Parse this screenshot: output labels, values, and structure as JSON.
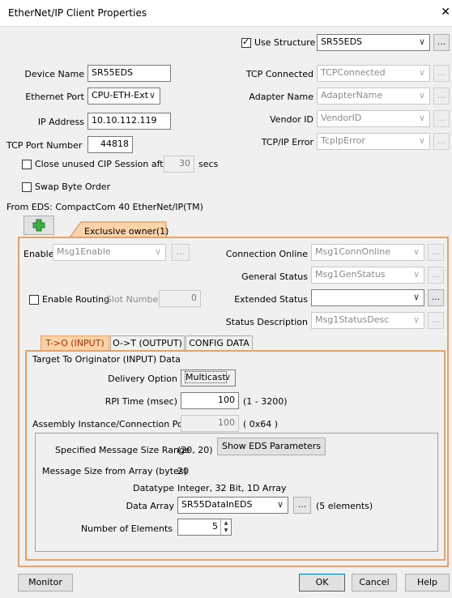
{
  "window": {
    "title": "EtherNet/IP Client Properties",
    "close": "✕"
  },
  "header": {
    "use_structure_label": "Use Structure",
    "use_structure_checked": true,
    "structure_value": "SR55EDS",
    "device_name_label": "Device Name",
    "device_name_value": "SR55EDS",
    "ethernet_port_label": "Ethernet Port",
    "ethernet_port_value": "CPU-ETH-Ext",
    "ip_address_label": "IP Address",
    "ip_address_value": "10.10.112.119",
    "tcp_port_label": "TCP Port Number",
    "tcp_port_value": "44818",
    "tcp_connected_label": "TCP Connected",
    "tcp_connected_value": "TCPConnected",
    "adapter_name_label": "Adapter Name",
    "adapter_name_value": "AdapterName",
    "vendor_id_label": "Vendor ID",
    "vendor_id_value": "VendorID",
    "tcpip_error_label": "TCP/IP Error",
    "tcpip_error_value": "TcpIpError",
    "close_unused_label": "Close unused CIP Session after",
    "close_unused_value": "30",
    "secs_label": "secs",
    "swap_byte_label": "Swap Byte Order",
    "from_eds_label": "From EDS: CompactCom 40 EtherNet/IP(TM)",
    "ellipsis": "..."
  },
  "conn_tab": {
    "label": "Exclusive owner(1)"
  },
  "conn": {
    "enable_label": "Enable",
    "enable_value": "Msg1Enable",
    "connection_online_label": "Connection Online",
    "connection_online_value": "Msg1ConnOnline",
    "general_status_label": "General Status",
    "general_status_value": "Msg1GenStatus",
    "enable_routing_label": "Enable Routing",
    "slot_number_label": "Slot Number",
    "slot_number_value": "0",
    "extended_status_label": "Extended Status",
    "extended_status_value": "",
    "status_description_label": "Status Description",
    "status_description_value": "Msg1StatusDesc"
  },
  "io_tabs": [
    {
      "label": "T->O (INPUT)",
      "active": true
    },
    {
      "label": "O->T (OUTPUT)",
      "active": false
    },
    {
      "label": "CONFIG DATA",
      "active": false
    }
  ],
  "input": {
    "group_title": "Target To Originator (INPUT) Data",
    "delivery_option_label": "Delivery Option",
    "delivery_option_value": "Multicast",
    "rpi_label": "RPI Time (msec)",
    "rpi_value": "100",
    "rpi_range": "(1 - 3200)",
    "assembly_label": "Assembly Instance/Connection Point",
    "assembly_value": "100",
    "assembly_hex": "( 0x64 )",
    "specified_range_label": "Specified Message Size Range",
    "specified_range_value": "(20, 20)",
    "show_eds_button": "Show EDS Parameters",
    "msg_size_label": "Message Size from Array (bytes)",
    "msg_size_value": "20",
    "datatype_label": "Datatype",
    "datatype_value": "Integer, 32 Bit, 1D Array",
    "data_array_label": "Data Array",
    "data_array_value": "SR55DataInEDS",
    "elements_note": "(5 elements)",
    "num_elements_label": "Number of Elements",
    "num_elements_value": "5"
  },
  "footer": {
    "monitor": "Monitor",
    "ok": "OK",
    "cancel": "Cancel",
    "help": "Help"
  },
  "colors": {
    "accent_orange": "#e3a26a",
    "tab_active_text": "#b33000",
    "add_icon_green": "#3cb043"
  }
}
